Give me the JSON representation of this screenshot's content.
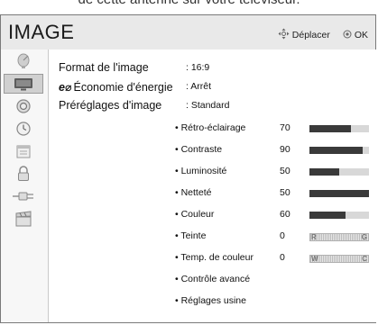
{
  "caption": "de cette antenne sur votre téléviseur.",
  "header": {
    "title": "IMAGE",
    "hint_move_icon": "dpad-icon",
    "hint_move": "Déplacer",
    "hint_ok_icon": "ok-circle-icon",
    "hint_ok": "OK"
  },
  "sidebar": {
    "items": [
      {
        "icon": "satellite-dish-icon"
      },
      {
        "icon": "tv-picture-icon",
        "selected": true
      },
      {
        "icon": "speaker-icon"
      },
      {
        "icon": "clock-icon"
      },
      {
        "icon": "calendar-icon"
      },
      {
        "icon": "lock-icon"
      },
      {
        "icon": "plug-icon"
      },
      {
        "icon": "clapperboard-icon"
      }
    ]
  },
  "settings": {
    "format": {
      "label": "Format de l'image",
      "value": ": 16:9"
    },
    "energy": {
      "icon": "eco-icon",
      "icon_text": "e⌀",
      "label": "Économie d'énergie",
      "value": ": Arrêt"
    },
    "presets": {
      "label": "Préréglages d'image",
      "value": ": Standard"
    }
  },
  "adjustments": [
    {
      "label": "• Rétro-éclairage",
      "value": "70",
      "level": 0.7
    },
    {
      "label": "• Contraste",
      "value": "90",
      "level": 0.9
    },
    {
      "label": "• Luminosité",
      "value": "50",
      "level": 0.5
    },
    {
      "label": "• Netteté",
      "value": "50",
      "level": 1.0
    },
    {
      "label": "• Couleur",
      "value": "60",
      "level": 0.6
    },
    {
      "label": "• Teinte",
      "value": "0",
      "balance": {
        "left": "R",
        "right": "G"
      }
    },
    {
      "label": "• Temp. de couleur",
      "value": "0",
      "balance": {
        "left": "W",
        "right": "C"
      }
    },
    {
      "label": "• Contrôle avancé"
    },
    {
      "label": "• Réglages usine"
    }
  ],
  "colors": {
    "panel_bg": "#e6e6e6",
    "selected_bg": "#d0d0d0",
    "bar_fill": "#3a3a3a",
    "bar_track": "#d8d8d8"
  }
}
